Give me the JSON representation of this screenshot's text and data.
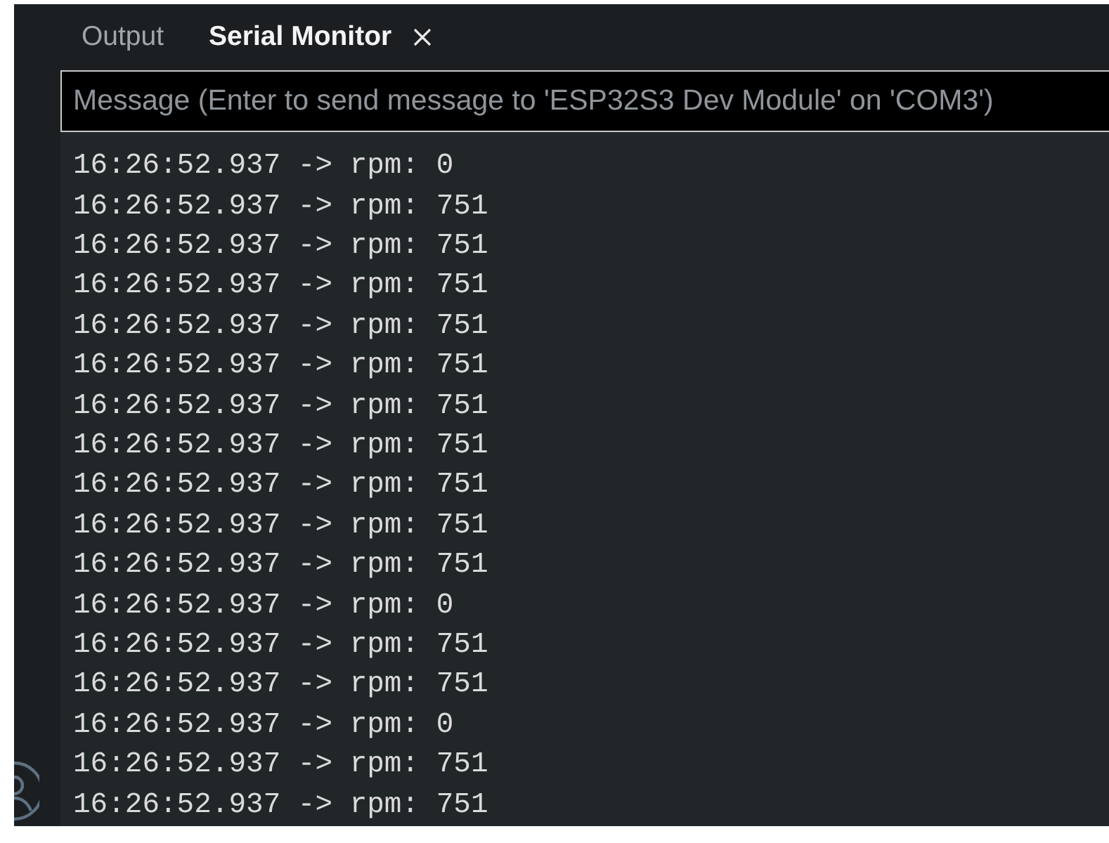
{
  "tabs": [
    {
      "label": "Output",
      "selected": false,
      "closable": false
    },
    {
      "label": "Serial Monitor",
      "selected": true,
      "closable": true
    }
  ],
  "message_field": {
    "placeholder": "Message (Enter to send message to 'ESP32S3 Dev Module' on 'COM3')"
  },
  "log_lines": [
    "16:26:52.937 -> rpm: 0",
    "16:26:52.937 -> rpm: 751",
    "16:26:52.937 -> rpm: 751",
    "16:26:52.937 -> rpm: 751",
    "16:26:52.937 -> rpm: 751",
    "16:26:52.937 -> rpm: 751",
    "16:26:52.937 -> rpm: 751",
    "16:26:52.937 -> rpm: 751",
    "16:26:52.937 -> rpm: 751",
    "16:26:52.937 -> rpm: 751",
    "16:26:52.937 -> rpm: 751",
    "16:26:52.937 -> rpm: 0",
    "16:26:52.937 -> rpm: 751",
    "16:26:52.937 -> rpm: 751",
    "16:26:52.937 -> rpm: 0",
    "16:26:52.937 -> rpm: 751",
    "16:26:52.937 -> rpm: 751"
  ]
}
